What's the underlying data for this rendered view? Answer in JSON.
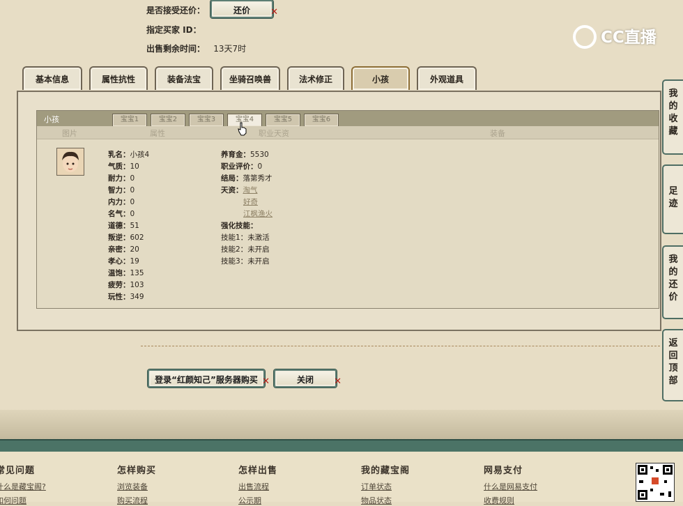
{
  "header": {
    "accept_bargain_label": "是否接受还价：",
    "bargain_button": "还价",
    "buyer_id_label": "指定买家 ID：",
    "remaining_label": "出售剩余时间：",
    "remaining_value": "13天7时"
  },
  "brand": {
    "text": "CC直播"
  },
  "tabs": [
    {
      "label": "基本信息"
    },
    {
      "label": "属性抗性"
    },
    {
      "label": "装备法宝"
    },
    {
      "label": "坐骑召唤兽"
    },
    {
      "label": "法术修正"
    },
    {
      "label": "小孩"
    },
    {
      "label": "外观道具"
    }
  ],
  "child_panel": {
    "title": "小孩",
    "subtabs": [
      "宝宝1",
      "宝宝2",
      "宝宝3",
      "宝宝4",
      "宝宝5",
      "宝宝6"
    ],
    "columns": [
      "图片",
      "属性",
      "职业天资",
      "装备"
    ],
    "attributes": [
      {
        "k": "乳名：",
        "v": "小孩4"
      },
      {
        "k": "气质：",
        "v": "10"
      },
      {
        "k": "耐力：",
        "v": "0"
      },
      {
        "k": "智力：",
        "v": "0"
      },
      {
        "k": "内力：",
        "v": "0"
      },
      {
        "k": "名气：",
        "v": "0"
      },
      {
        "k": "道德：",
        "v": "51"
      },
      {
        "k": "叛逆：",
        "v": "602"
      },
      {
        "k": "亲密：",
        "v": "20"
      },
      {
        "k": "孝心：",
        "v": "19"
      },
      {
        "k": "温饱：",
        "v": "135"
      },
      {
        "k": "疲劳：",
        "v": "103"
      },
      {
        "k": "玩性：",
        "v": "349"
      }
    ],
    "career": {
      "cost_label": "养育金：",
      "cost": "5530",
      "eval_label": "职业评价：",
      "eval": "0",
      "ending_label": "结局：",
      "ending": "落第秀才",
      "talent_label": "天资：",
      "talents": [
        "淘气",
        "好奇",
        "江枫渔火"
      ],
      "skill_label": "强化技能：",
      "skill1_label": "技能1：",
      "skill1": "未激活",
      "skill2_label": "技能2：",
      "skill2": "未开启",
      "skill3_label": "技能3：",
      "skill3": "未开启"
    }
  },
  "actions": {
    "login_buy": "登录“红颜知己”服务器购买",
    "close": "关闭"
  },
  "side_tabs": [
    "我的收藏",
    "足迹",
    "我的还价",
    "返回顶部"
  ],
  "footer": {
    "cols": [
      {
        "title": "常见问题",
        "l1": "什么是藏宝阁?",
        "l2": "如何问题"
      },
      {
        "title": "怎样购买",
        "l1": "浏览装备",
        "l2": "购买流程"
      },
      {
        "title": "怎样出售",
        "l1": "出售流程",
        "l2": "公示期"
      },
      {
        "title": "我的藏宝阁",
        "l1": "订单状态",
        "l2": "物品状态"
      },
      {
        "title": "网易支付",
        "l1": "什么是网易支付",
        "l2": "收费规则"
      }
    ]
  }
}
